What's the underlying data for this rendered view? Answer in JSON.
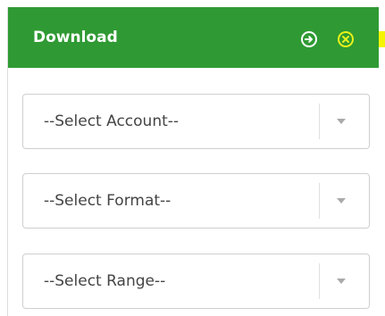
{
  "panel": {
    "title": "Download",
    "header_color": "#2f9a33",
    "icons": [
      "arrow-circle-right-icon",
      "close-circle-icon"
    ]
  },
  "selects": [
    {
      "value": "--Select Account--"
    },
    {
      "value": "--Select Format--"
    },
    {
      "value": "--Select Range--"
    }
  ]
}
